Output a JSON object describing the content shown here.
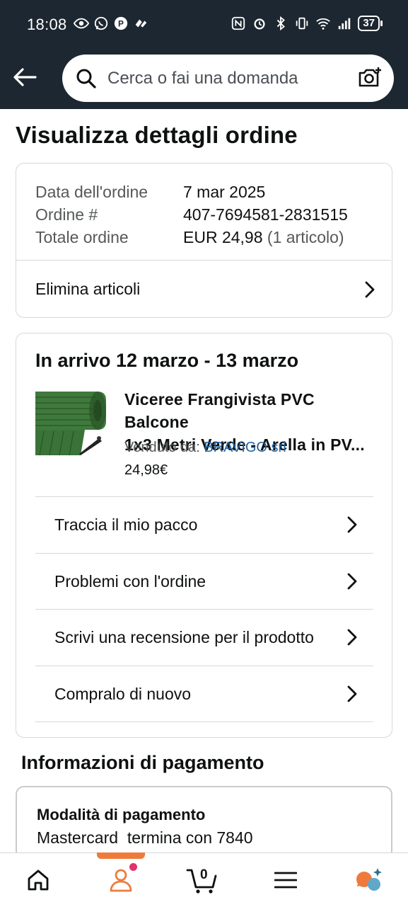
{
  "status_bar": {
    "time": "18:08",
    "battery": "37"
  },
  "header": {
    "search_placeholder": "Cerca o fai una domanda"
  },
  "page_title": "Visualizza dettagli ordine",
  "order_summary": {
    "date_label": "Data dell'ordine",
    "date_value": "7 mar 2025",
    "number_label": "Ordine #",
    "number_value": "407-7694581-2831515",
    "total_label": "Totale ordine",
    "total_value": "EUR 24,98",
    "total_items": "(1 articolo)",
    "delete_items": "Elimina articoli"
  },
  "shipment": {
    "arrival": "In arrivo 12 marzo - 13 marzo",
    "product_title_line1": "Viceree Frangivista PVC Balcone",
    "product_title_line2": "1x3 Metri Verde - Arella in PV...",
    "sold_by_label": "Venduto da:",
    "seller": "BRAVIGO srl",
    "price": "24,98€",
    "actions": [
      {
        "label": "Traccia il mio pacco"
      },
      {
        "label": "Problemi con l'ordine"
      },
      {
        "label": "Scrivi una recensione per il prodotto"
      },
      {
        "label": "Compralo di nuovo"
      }
    ]
  },
  "payment": {
    "section_title": "Informazioni di pagamento",
    "method_label": "Modalità di pagamento",
    "method_value": "Mastercard  termina con 7840"
  },
  "bottom_nav": {
    "cart_count": "0",
    "active": "account",
    "accent": "#ee7b3b",
    "notification_dot": "#e2336b",
    "items": [
      "home-icon",
      "account-icon",
      "cart-icon",
      "menu-icon",
      "assistant-icon"
    ]
  },
  "colors": {
    "header_bg": "#1d2731",
    "link": "#2162a1",
    "border": "#d5d9d9"
  }
}
